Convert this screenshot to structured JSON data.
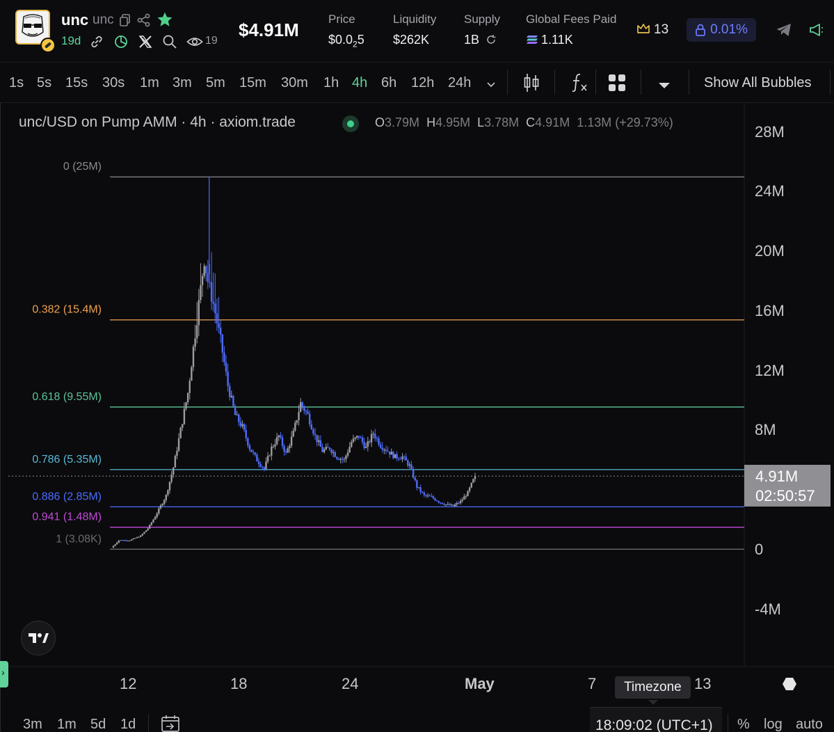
{
  "token": {
    "ticker": "unc",
    "name": "unc",
    "age": "19d",
    "watchers": "19",
    "market_cap": "$4.91M"
  },
  "stats": [
    {
      "label": "Price",
      "value_main": "$0.0",
      "value_sub": "2",
      "value_tail": "5"
    },
    {
      "label": "Liquidity",
      "value": "$262K"
    },
    {
      "label": "Supply",
      "value": "1B"
    },
    {
      "label": "Global Fees Paid",
      "value": "1.11K"
    }
  ],
  "header_right": {
    "crown_count": "13",
    "fee_pct": "0.01%"
  },
  "timeframes": [
    "1s",
    "5s",
    "15s",
    "30s",
    "1m",
    "3m",
    "5m",
    "15m",
    "30m",
    "1h",
    "4h",
    "6h",
    "12h",
    "24h"
  ],
  "active_timeframe": "4h",
  "toolbar": {
    "show_bubbles": "Show All Bubbles"
  },
  "legend": {
    "title": "unc/USD on Pump AMM · 4h · axiom.trade",
    "o_key": "O",
    "o": "3.79M",
    "h_key": "H",
    "h": "4.95M",
    "l_key": "L",
    "l": "3.78M",
    "c_key": "C",
    "c": "4.91M",
    "change": "1.13M (+29.73%)"
  },
  "current_price": {
    "value": "4.91M",
    "countdown": "02:50:57"
  },
  "y_axis_labels": [
    "28M",
    "24M",
    "20M",
    "16M",
    "12M",
    "8M",
    "0",
    "-4M"
  ],
  "x_axis_labels": [
    "12",
    "18",
    "24",
    "May",
    "7",
    "13"
  ],
  "timezone_tooltip": "Timezone",
  "bottom": {
    "ranges": [
      "3m",
      "1m",
      "5d",
      "1d"
    ],
    "clock": "18:09:02 (UTC+1)",
    "percent": "%",
    "log": "log",
    "auto": "auto"
  },
  "chart_data": {
    "type": "candlestick",
    "y_range": [
      -4000000,
      28000000
    ],
    "fib_levels": [
      {
        "label": "0 (25M)",
        "value": 25000000,
        "color": "#8a8a90"
      },
      {
        "label": "0.382 (15.4M)",
        "value": 15400000,
        "color": "#f0a050"
      },
      {
        "label": "0.618 (9.55M)",
        "value": 9550000,
        "color": "#5fc39a"
      },
      {
        "label": "0.786 (5.35M)",
        "value": 5350000,
        "color": "#5ab8d8"
      },
      {
        "label": "0.886 (2.85M)",
        "value": 2850000,
        "color": "#4a6cff"
      },
      {
        "label": "0.941 (1.48M)",
        "value": 1480000,
        "color": "#c04ad8"
      },
      {
        "label": "1 (3.08K)",
        "value": 3080,
        "color": "#6a6a70"
      }
    ],
    "last_close": 4910000,
    "path": [
      [
        0,
        0.1
      ],
      [
        0.02,
        0.6
      ],
      [
        0.05,
        0.6
      ],
      [
        0.08,
        0.9
      ],
      [
        0.1,
        1.4
      ],
      [
        0.12,
        2.2
      ],
      [
        0.15,
        3.6
      ],
      [
        0.17,
        5.5
      ],
      [
        0.19,
        8.0
      ],
      [
        0.21,
        10.5
      ],
      [
        0.23,
        14.5
      ],
      [
        0.245,
        17.5
      ],
      [
        0.255,
        19.5
      ],
      [
        0.265,
        18.0
      ],
      [
        0.28,
        16.5
      ],
      [
        0.3,
        14.0
      ],
      [
        0.32,
        11.0
      ],
      [
        0.34,
        9.0
      ],
      [
        0.36,
        8.2
      ],
      [
        0.38,
        6.8
      ],
      [
        0.4,
        6.0
      ],
      [
        0.42,
        5.4
      ],
      [
        0.44,
        6.8
      ],
      [
        0.46,
        7.6
      ],
      [
        0.48,
        6.4
      ],
      [
        0.5,
        7.8
      ],
      [
        0.52,
        9.8
      ],
      [
        0.54,
        9.0
      ],
      [
        0.56,
        7.6
      ],
      [
        0.58,
        6.6
      ],
      [
        0.6,
        6.8
      ],
      [
        0.62,
        6.2
      ],
      [
        0.64,
        6.0
      ],
      [
        0.66,
        7.2
      ],
      [
        0.68,
        7.6
      ],
      [
        0.7,
        6.8
      ],
      [
        0.72,
        7.8
      ],
      [
        0.74,
        7.0
      ],
      [
        0.76,
        6.6
      ],
      [
        0.78,
        6.2
      ],
      [
        0.8,
        6.2
      ],
      [
        0.82,
        5.6
      ],
      [
        0.84,
        4.2
      ],
      [
        0.86,
        3.6
      ],
      [
        0.88,
        3.5
      ],
      [
        0.9,
        3.2
      ],
      [
        0.92,
        3.0
      ],
      [
        0.94,
        2.9
      ],
      [
        0.96,
        3.2
      ],
      [
        0.98,
        3.8
      ],
      [
        1.0,
        4.91
      ]
    ]
  }
}
